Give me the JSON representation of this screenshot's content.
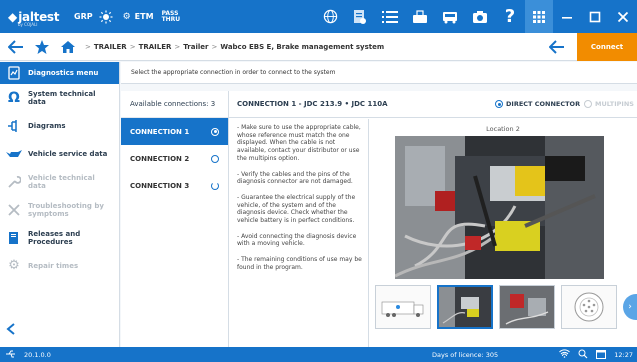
{
  "topbar": {
    "logo_text": "jaltest",
    "logo_subtext": "by COJALI",
    "grp_label": "GRP",
    "etm_label": "ETM",
    "pass_thru_label": "PASS\nTHRU",
    "icons": [
      "globe-icon",
      "report-icon",
      "list-icon",
      "device-icon",
      "bus-icon",
      "camera-icon",
      "help-icon",
      "apps-icon",
      "minimize-icon",
      "maximize-icon",
      "close-icon"
    ]
  },
  "navbar": {
    "breadcrumb": [
      "TRAILER",
      "TRAILER",
      "Trailer",
      "Wabco EBS E, Brake management system"
    ],
    "connect_label": "Connect"
  },
  "sidebar": {
    "header": "Diagnostics menu",
    "items": [
      {
        "label": "System technical data",
        "icon": "ohm-icon",
        "enabled": true
      },
      {
        "label": "Diagrams",
        "icon": "diagram-icon",
        "enabled": true
      },
      {
        "label": "Vehicle service data",
        "icon": "oil-can-icon",
        "enabled": true
      },
      {
        "label": "Vehicle technical data",
        "icon": "wrench-icon",
        "enabled": false
      },
      {
        "label": "Troubleshooting by symptoms",
        "icon": "tools-icon",
        "enabled": false
      },
      {
        "label": "Releases and Procedures",
        "icon": "book-icon",
        "enabled": true
      },
      {
        "label": "Repair times",
        "icon": "gear-icon",
        "enabled": false
      }
    ]
  },
  "main": {
    "instruction": "Select the appropriate connection in order to connect to the system",
    "available_label": "Available connections: 3",
    "connections": [
      {
        "label": "CONNECTION 1",
        "selected": true
      },
      {
        "label": "CONNECTION 2",
        "selected": false
      },
      {
        "label": "CONNECTION 3",
        "selected": false
      }
    ],
    "detail_title": "CONNECTION 1 - JDC 213.9 • JDC 110A",
    "direct_connector_label": "DIRECT CONNECTOR",
    "multipins_label": "MULTIPINS",
    "notes": [
      "- Make sure to use the appropriate cable, whose reference must match the one displayed. When the cable is not available, contact your distributor or use the multipins option.",
      "- Verify the cables and the pins of the diagnosis connector are not damaged.",
      "- Guarantee the electrical supply of the vehicle, of the system and of the diagnosis device. Check whether the vehicle battery is in perfect conditions.",
      "- Avoid connecting the diagnosis device with a moving vehicle.",
      "- The remaining conditions of use may be found in the program."
    ],
    "location_label": "Location 2"
  },
  "statusbar": {
    "version": "20.1.0.0",
    "licence": "Days of licence: 305",
    "time": "12:27"
  },
  "colors": {
    "primary": "#1673c9",
    "accent": "#f28c00",
    "disabled": "#b5bcc3"
  }
}
